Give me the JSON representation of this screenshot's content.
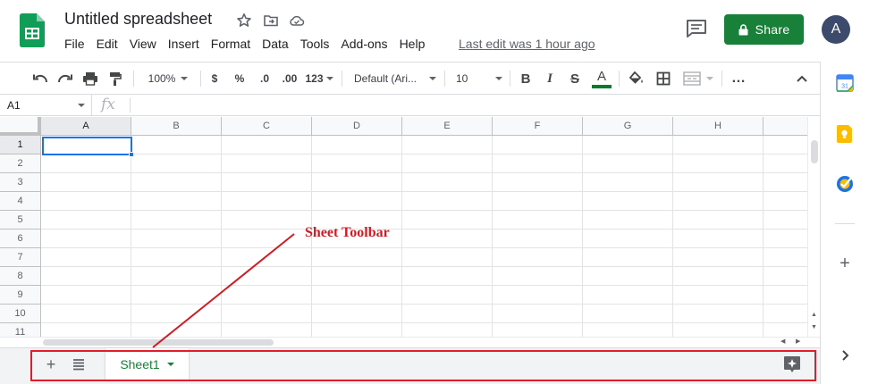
{
  "header": {
    "title": "Untitled spreadsheet",
    "menu": [
      "File",
      "Edit",
      "View",
      "Insert",
      "Format",
      "Data",
      "Tools",
      "Add-ons",
      "Help"
    ],
    "last_edit": "Last edit was 1 hour ago",
    "share_label": "Share",
    "avatar_initial": "A",
    "brand_color": "#188038"
  },
  "toolbar": {
    "zoom": "100%",
    "currency": "$",
    "percent": "%",
    "decrease_decimal": ".0",
    "increase_decimal": ".00",
    "more_formats": "123",
    "font": "Default (Ari...",
    "font_size": "10",
    "bold": "B",
    "italic": "I",
    "strike": "S",
    "text_color": "A",
    "more": "…",
    "icons": [
      "undo-icon",
      "redo-icon",
      "print-icon",
      "paint-format-icon",
      "fill-color-icon",
      "borders-icon",
      "merge-cells-icon",
      "collapse-icon"
    ]
  },
  "formula_bar": {
    "cell_ref": "A1",
    "fx": "fx",
    "value": ""
  },
  "grid": {
    "columns": [
      "A",
      "B",
      "C",
      "D",
      "E",
      "F",
      "G",
      "H"
    ],
    "rows": [
      "1",
      "2",
      "3",
      "4",
      "5",
      "6",
      "7",
      "8",
      "9",
      "10",
      "11"
    ],
    "active_cell": "A1"
  },
  "sheet_bar": {
    "tabs": [
      {
        "label": "Sheet1",
        "active": true
      }
    ],
    "active_color": "#188038"
  },
  "side_panel": {
    "icons": [
      "calendar-icon",
      "keep-icon",
      "tasks-icon",
      "add-icon",
      "expand-icon"
    ],
    "calendar_day": "31"
  },
  "annotation": {
    "label": "Sheet Toolbar",
    "color": "#d01c24"
  }
}
